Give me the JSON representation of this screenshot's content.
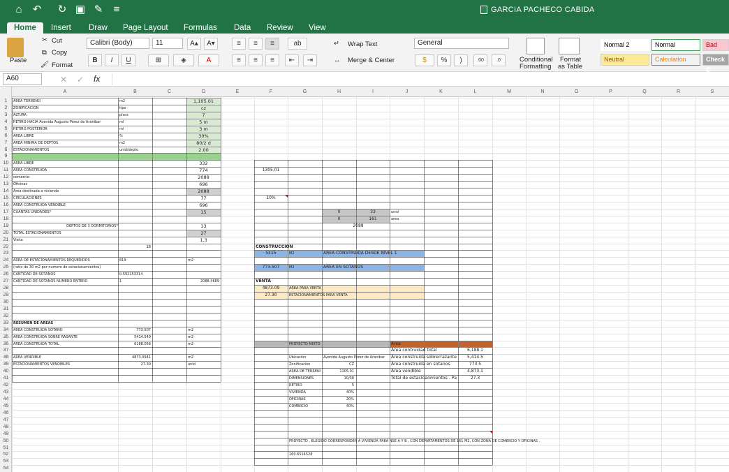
{
  "title": "GARCIA PACHECO CABIDA",
  "tabs": [
    "Home",
    "Insert",
    "Draw",
    "Page Layout",
    "Formulas",
    "Data",
    "Review",
    "View"
  ],
  "ribbon": {
    "paste": "Paste",
    "cut": "Cut",
    "copy": "Copy",
    "format": "Format",
    "font": "Calibri (Body)",
    "size": "11",
    "wrap": "Wrap Text",
    "merge": "Merge & Center",
    "numfmt": "General",
    "cond": "Conditional",
    "cond2": "Formatting",
    "fmt": "Format",
    "fmt2": "as Table",
    "styles": [
      "Normal 2",
      "Normal",
      "Bad",
      "Neutral",
      "Calculation",
      "Check C"
    ],
    "bold": "B",
    "italic": "I",
    "underline": "U",
    "grow": "A▴",
    "shrink": "A▾",
    "pct": "%",
    "comma": ")",
    "inc": ".00",
    "dec": ".0"
  },
  "namebox": "A60",
  "fx": "fx",
  "columns": [
    "A",
    "B",
    "C",
    "D",
    "E",
    "F",
    "G",
    "H",
    "I",
    "J",
    "K",
    "L",
    "M",
    "N",
    "O",
    "P",
    "Q",
    "R",
    "S"
  ],
  "rows": [
    "1",
    "2",
    "3",
    "4",
    "5",
    "6",
    "7",
    "8",
    "9",
    "10",
    "11",
    "12",
    "13",
    "14",
    "15",
    "16",
    "17",
    "18",
    "19",
    "20",
    "21",
    "22",
    "23",
    "24",
    "25",
    "26",
    "27",
    "28",
    "29",
    "30",
    "31",
    "32",
    "33",
    "34",
    "35",
    "36",
    "37",
    "38",
    "39",
    "40",
    "41",
    "42",
    "43",
    "44",
    "45",
    "46",
    "47",
    "48",
    "49",
    "50",
    "51",
    "52",
    "53",
    "54"
  ],
  "cells": [
    {
      "r": 1,
      "c": "A",
      "v": "AREA TERRENO"
    },
    {
      "r": 1,
      "c": "B",
      "v": "m2"
    },
    {
      "r": 1,
      "c": "D",
      "v": "1,105.01"
    },
    {
      "r": 2,
      "c": "A",
      "v": "ZONIFICACION"
    },
    {
      "r": 2,
      "c": "B",
      "v": "tipo"
    },
    {
      "r": 2,
      "c": "D",
      "v": "cz"
    },
    {
      "r": 3,
      "c": "A",
      "v": "ALTURA"
    },
    {
      "r": 3,
      "c": "B",
      "v": "pisos"
    },
    {
      "r": 3,
      "c": "D",
      "v": "7"
    },
    {
      "r": 4,
      "c": "A",
      "v": "RETIRO HACIA Avenida Augusto Pérez de Aranibar"
    },
    {
      "r": 4,
      "c": "B",
      "v": "ml"
    },
    {
      "r": 4,
      "c": "D",
      "v": "5 m"
    },
    {
      "r": 5,
      "c": "A",
      "v": "RETIRO POSTERIOR"
    },
    {
      "r": 5,
      "c": "B",
      "v": "ml"
    },
    {
      "r": 5,
      "c": "D",
      "v": "3 m"
    },
    {
      "r": 6,
      "c": "A",
      "v": "AREA LIBRE"
    },
    {
      "r": 6,
      "c": "B",
      "v": "%"
    },
    {
      "r": 6,
      "c": "D",
      "v": "30%"
    },
    {
      "r": 7,
      "c": "A",
      "v": "AREA MINIMA DE DEPTOS"
    },
    {
      "r": 7,
      "c": "B",
      "v": "m2"
    },
    {
      "r": 7,
      "c": "D",
      "v": "80/2 d"
    },
    {
      "r": 8,
      "c": "A",
      "v": "ESTACIONAMIENTOS"
    },
    {
      "r": 8,
      "c": "B",
      "v": "unid/depto"
    },
    {
      "r": 8,
      "c": "D",
      "v": "2.00"
    },
    {
      "r": 10,
      "c": "A",
      "v": "AREA LIBRE"
    },
    {
      "r": 10,
      "c": "D",
      "v": "332"
    },
    {
      "r": 11,
      "c": "A",
      "v": "AREA CONSTRUIDA"
    },
    {
      "r": 11,
      "c": "D",
      "v": "774"
    },
    {
      "r": 12,
      "c": "A",
      "v": "comercio"
    },
    {
      "r": 12,
      "c": "D",
      "v": "2088"
    },
    {
      "r": 13,
      "c": "A",
      "v": "Oficinas"
    },
    {
      "r": 13,
      "c": "D",
      "v": "696"
    },
    {
      "r": 14,
      "c": "A",
      "v": "Area destinada a vivienda"
    },
    {
      "r": 14,
      "c": "D",
      "v": "2088"
    },
    {
      "r": 15,
      "c": "A",
      "v": "CIRCULACIONES"
    },
    {
      "r": 15,
      "c": "D",
      "v": "77"
    },
    {
      "r": 16,
      "c": "A",
      "v": "AREA CONSTRUIDA VENDIBLE"
    },
    {
      "r": 16,
      "c": "D",
      "v": "696"
    },
    {
      "r": 17,
      "c": "A",
      "v": "CUANTAS UNIDADES?"
    },
    {
      "r": 17,
      "c": "D",
      "v": "15"
    },
    {
      "r": 19,
      "c": "A",
      "v": "DEPTOS DE 3 DORMITORIOS?"
    },
    {
      "r": 19,
      "c": "D",
      "v": "13"
    },
    {
      "r": 20,
      "c": "A",
      "v": "TOTAL ESTACIONAMIENTOS"
    },
    {
      "r": 20,
      "c": "D",
      "v": "27"
    },
    {
      "r": 21,
      "c": "A",
      "v": "Visita"
    },
    {
      "r": 21,
      "c": "D",
      "v": "1.3"
    },
    {
      "r": 22,
      "c": "B",
      "v": "18"
    },
    {
      "r": 24,
      "c": "A",
      "v": "AREA DE ESTACIONAMIENTOS REQUERIDOS"
    },
    {
      "r": 24,
      "c": "B",
      "v": "819"
    },
    {
      "r": 24,
      "c": "D",
      "v": "m2"
    },
    {
      "r": 25,
      "c": "A",
      "v": "(ratio de 30 m2 por numero de estacionamientos)"
    },
    {
      "r": 26,
      "c": "A",
      "v": "CANTIDAD DE SOTANOS"
    },
    {
      "r": 26,
      "c": "B",
      "v": "0.592153314"
    },
    {
      "r": 27,
      "c": "A",
      "v": "CANTIDAD DE SOTANOS NUMERO ENTERO"
    },
    {
      "r": 27,
      "c": "B",
      "v": "1"
    },
    {
      "r": 27,
      "c": "D",
      "v": "2088.4689"
    },
    {
      "r": 33,
      "c": "A",
      "v": "RESUMEN DE AREAS"
    },
    {
      "r": 34,
      "c": "A",
      "v": "AREA CONSTRUIDA SOTANO"
    },
    {
      "r": 34,
      "c": "B",
      "v": "773.507"
    },
    {
      "r": 34,
      "c": "D",
      "v": "m2"
    },
    {
      "r": 35,
      "c": "A",
      "v": "AREA CONSTRUIDA SOBRE RASANTE"
    },
    {
      "r": 35,
      "c": "B",
      "v": "5414.549"
    },
    {
      "r": 35,
      "c": "D",
      "v": "m2"
    },
    {
      "r": 36,
      "c": "A",
      "v": "AREA CONSTRUIDA TOTAL"
    },
    {
      "r": 36,
      "c": "B",
      "v": "6188.056"
    },
    {
      "r": 36,
      "c": "D",
      "v": "m2"
    },
    {
      "r": 38,
      "c": "A",
      "v": "AREA VENDIBLE"
    },
    {
      "r": 38,
      "c": "B",
      "v": "4873.0941"
    },
    {
      "r": 38,
      "c": "D",
      "v": "m2"
    },
    {
      "r": 39,
      "c": "A",
      "v": "ESTACIONAMIENTOS VENDIBLES"
    },
    {
      "r": 39,
      "c": "B",
      "v": "27.30"
    },
    {
      "r": 39,
      "c": "D",
      "v": "unid"
    },
    {
      "r": 11,
      "c": "F",
      "v": "1305.01"
    },
    {
      "r": 15,
      "c": "F",
      "v": "10%"
    },
    {
      "r": 17,
      "c": "H",
      "v": "0"
    },
    {
      "r": 17,
      "c": "I",
      "v": "33"
    },
    {
      "r": 17,
      "c": "J",
      "v": "unid"
    },
    {
      "r": 18,
      "c": "H",
      "v": "0"
    },
    {
      "r": 18,
      "c": "I",
      "v": "161"
    },
    {
      "r": 18,
      "c": "J",
      "v": "area"
    },
    {
      "r": 19,
      "c": "H",
      "v": "2088"
    },
    {
      "r": 22,
      "c": "F",
      "v": "CONSTRUCCION"
    },
    {
      "r": 23,
      "c": "F",
      "v": "5415"
    },
    {
      "r": 23,
      "c": "G",
      "v": "M2"
    },
    {
      "r": 23,
      "c": "H",
      "v": "AREA CONSTRUIDA DESDE NIVEL 1"
    },
    {
      "r": 25,
      "c": "F",
      "v": "773.507"
    },
    {
      "r": 25,
      "c": "G",
      "v": "M2"
    },
    {
      "r": 25,
      "c": "H",
      "v": "AREA EN SOTANOS"
    },
    {
      "r": 27,
      "c": "F",
      "v": "VENTA"
    },
    {
      "r": 28,
      "c": "F",
      "v": "4873.09"
    },
    {
      "r": 28,
      "c": "G",
      "v": "AREA PARA VENTA"
    },
    {
      "r": 29,
      "c": "F",
      "v": "27.30"
    },
    {
      "r": 29,
      "c": "G",
      "v": "ESTACIONAMIENTOS PARA VENTA"
    },
    {
      "r": 36,
      "c": "G",
      "v": "PROYECTO MIXTO"
    },
    {
      "r": 36,
      "c": "J",
      "v": "Area"
    },
    {
      "r": 37,
      "c": "J",
      "v": "Área contruidad total"
    },
    {
      "r": 37,
      "c": "L",
      "v": "6,188.1"
    },
    {
      "r": 38,
      "c": "G",
      "v": "Ubicación"
    },
    {
      "r": 38,
      "c": "H",
      "v": "Avenida Augusto Pérez de Aranibar"
    },
    {
      "r": 38,
      "c": "J",
      "v": "Área construida sobrerrazante"
    },
    {
      "r": 38,
      "c": "L",
      "v": "5,414.5"
    },
    {
      "r": 39,
      "c": "G",
      "v": "Zonificación"
    },
    {
      "r": 39,
      "c": "H",
      "v": "CZ"
    },
    {
      "r": 39,
      "c": "J",
      "v": "Área construida en sotanos"
    },
    {
      "r": 39,
      "c": "L",
      "v": "773.5"
    },
    {
      "r": 40,
      "c": "G",
      "v": "AREA DE TERRENO"
    },
    {
      "r": 40,
      "c": "H",
      "v": "1105.01"
    },
    {
      "r": 40,
      "c": "J",
      "v": "Área vendible"
    },
    {
      "r": 40,
      "c": "L",
      "v": "4,873.1"
    },
    {
      "r": 41,
      "c": "G",
      "v": "DIMENSIONES"
    },
    {
      "r": 41,
      "c": "H",
      "v": "10/38"
    },
    {
      "r": 41,
      "c": "J",
      "v": "Total de estacioanmientos . Pa"
    },
    {
      "r": 41,
      "c": "L",
      "v": "27.3"
    },
    {
      "r": 42,
      "c": "G",
      "v": "RETIRO"
    },
    {
      "r": 42,
      "c": "H",
      "v": "5"
    },
    {
      "r": 43,
      "c": "G",
      "v": "VIVIENDA"
    },
    {
      "r": 43,
      "c": "H",
      "v": "40%"
    },
    {
      "r": 44,
      "c": "G",
      "v": "OFICINAS"
    },
    {
      "r": 44,
      "c": "H",
      "v": "20%"
    },
    {
      "r": 45,
      "c": "G",
      "v": "COMERCIO"
    },
    {
      "r": 45,
      "c": "H",
      "v": "40%"
    },
    {
      "r": 50,
      "c": "G",
      "v": "PROYECTO , ELEGIDO CORRESPONDER A VIVIENDA PARA NSE A Y B , CON DEPARTAMENTOS DE 161 M2, CON ZONA DE COMERCIO Y OFICINAS ."
    },
    {
      "r": 52,
      "c": "G",
      "v": "160.6514528"
    }
  ]
}
